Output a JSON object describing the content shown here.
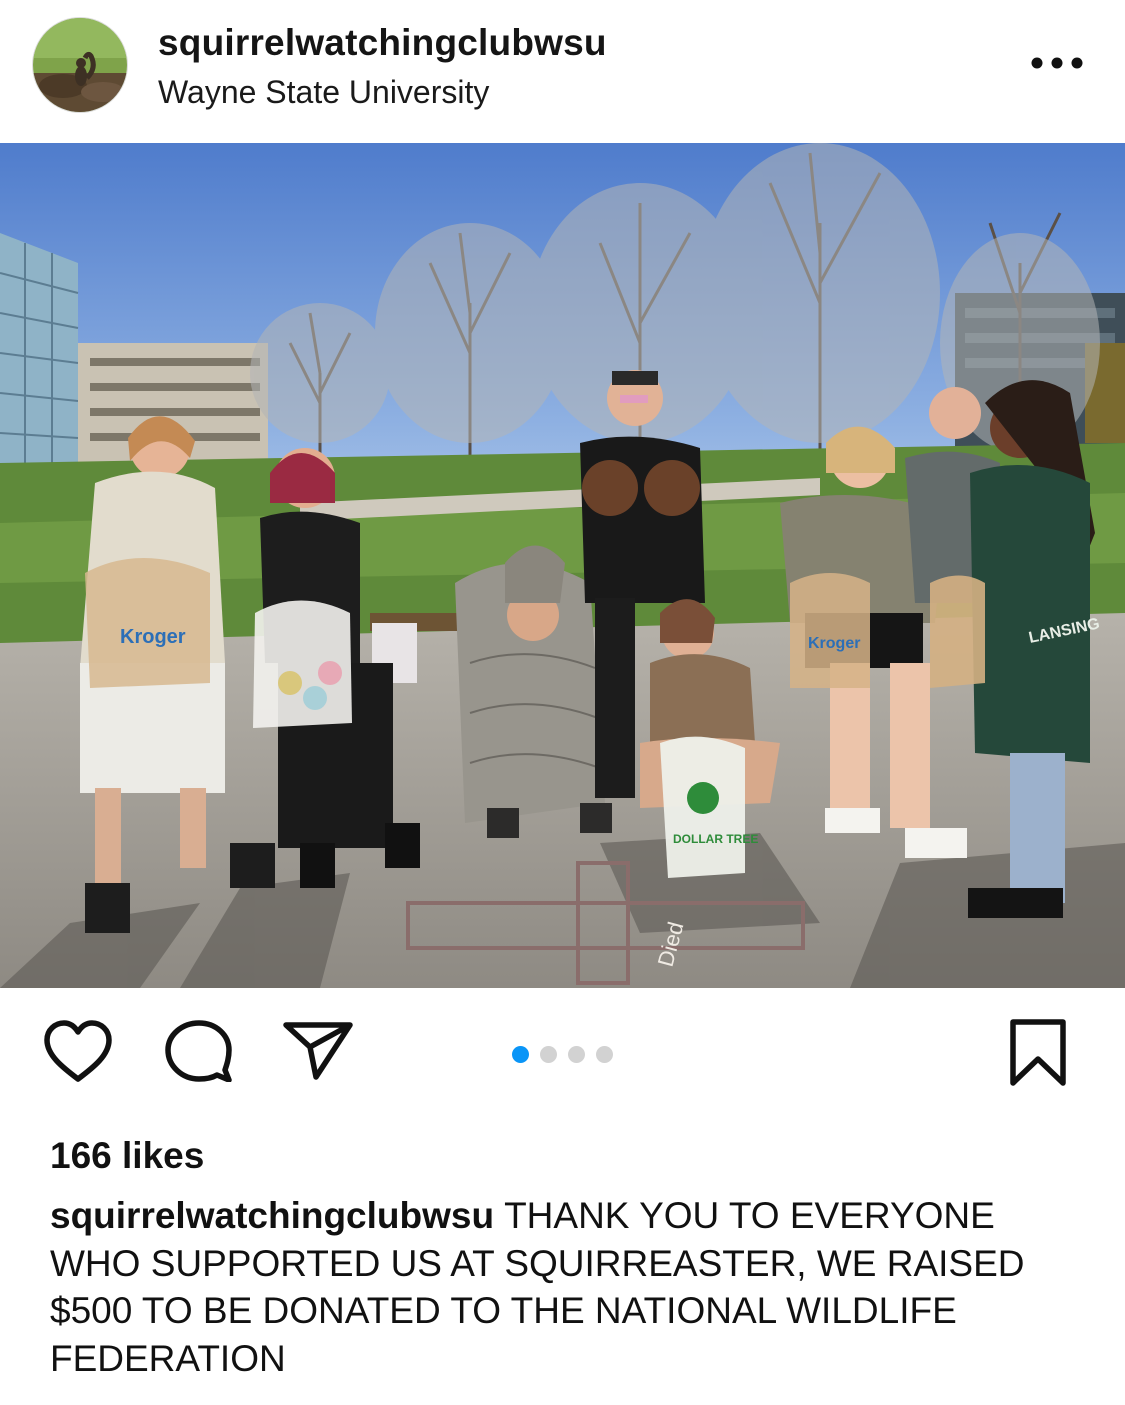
{
  "post": {
    "account": {
      "username": "squirrelwatchingclubwsu",
      "location": "Wayne State University",
      "avatar_icon": "squirrel-avatar"
    },
    "menu_icon": "more-horizontal-icon",
    "photo": {
      "description_icon": "group-photo",
      "bag_labels": [
        "Kroger",
        "Kroger",
        "DOLLAR TREE"
      ],
      "jersey_text": "LANSING",
      "chalk_text": "Died"
    },
    "actions": {
      "like_icon": "heart-icon",
      "comment_icon": "comment-icon",
      "share_icon": "send-icon",
      "save_icon": "bookmark-icon"
    },
    "carousel": {
      "total": 4,
      "active_index": 0
    },
    "likes_text": "166 likes",
    "caption": {
      "username": "squirrelwatchingclubwsu",
      "text": "THANK YOU TO EVERYONE WHO SUPPORTED US AT SQUIRREASTER, WE RAISED $500 TO BE DONATED TO THE NATIONAL WILDLIFE FEDERATION"
    },
    "colors": {
      "accent_dot": "#0a95f7",
      "inactive_dot": "#d2d2d2",
      "text": "#111111"
    }
  }
}
